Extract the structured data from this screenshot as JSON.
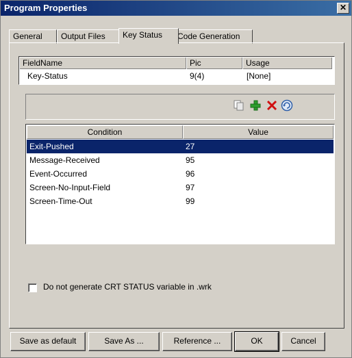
{
  "window": {
    "title": "Program Properties"
  },
  "tabs": [
    {
      "label": "General"
    },
    {
      "label": "Output Files"
    },
    {
      "label": "Key Status"
    },
    {
      "label": "Code Generation"
    }
  ],
  "field_table": {
    "columns": [
      "FieldName",
      "Pic",
      "Usage"
    ],
    "row": {
      "fieldname": "Key-Status",
      "pic": "9(4)",
      "usage": "[None]"
    }
  },
  "toolbar": {
    "icons": [
      "copy-icon",
      "add-icon",
      "delete-icon",
      "refresh-icon"
    ]
  },
  "conditions_table": {
    "columns": [
      "Condition",
      "Value"
    ],
    "rows": [
      {
        "condition": "Exit-Pushed",
        "value": "27",
        "selected": true
      },
      {
        "condition": "Message-Received",
        "value": "95"
      },
      {
        "condition": "Event-Occurred",
        "value": "96"
      },
      {
        "condition": "Screen-No-Input-Field",
        "value": "97"
      },
      {
        "condition": "Screen-Time-Out",
        "value": "99"
      }
    ]
  },
  "options": {
    "no_crt_status_label": "Do not generate CRT STATUS variable in .wrk",
    "no_crt_status_checked": false
  },
  "buttons": {
    "save_default": "Save as default",
    "save_as": "Save As ...",
    "reference": "Reference ...",
    "ok": "OK",
    "cancel": "Cancel"
  },
  "colors": {
    "selection": "#0a246a",
    "titlebar": "#0a246a",
    "face": "#d4d0c8"
  }
}
